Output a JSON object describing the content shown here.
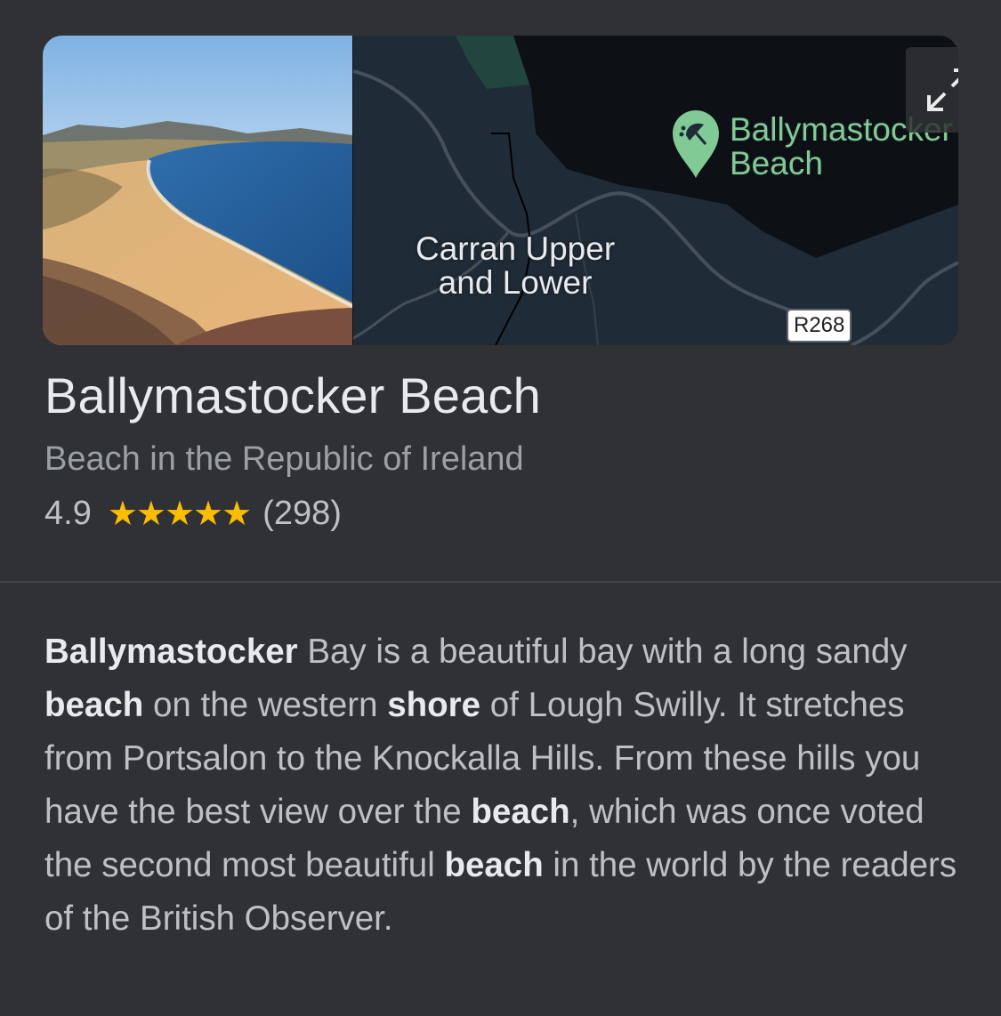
{
  "place": {
    "title": "Ballymastocker Beach",
    "subtitle": "Beach in the Republic of Ireland",
    "rating": "4.9",
    "stars": "★★★★★",
    "review_count": "(298)",
    "rating_value": 4.9,
    "rating_max": 5
  },
  "map": {
    "town_label_line1": "Carran Upper",
    "town_label_line2": "and Lower",
    "place_label_line1": "Ballymastocker",
    "place_label_line2": "Beach",
    "road_label": "R268",
    "pin_icon": "beach-umbrella-icon",
    "expand_icon": "expand-diagonal-icon"
  },
  "description": {
    "segments": [
      {
        "text": "Ballymastocker",
        "bold": true
      },
      {
        "text": " Bay is a beautiful bay with a long sandy ",
        "bold": false
      },
      {
        "text": "beach",
        "bold": true
      },
      {
        "text": " on the western ",
        "bold": false
      },
      {
        "text": "shore",
        "bold": true
      },
      {
        "text": " of Lough Swilly. It stretches from Portsalon to the Knockalla Hills. From these hills you have the best view over the ",
        "bold": false
      },
      {
        "text": "beach",
        "bold": true
      },
      {
        "text": ", which was once voted the second most beautiful ",
        "bold": false
      },
      {
        "text": "beach",
        "bold": true
      },
      {
        "text": " in the world by the readers of the British Observer.",
        "bold": false
      }
    ]
  },
  "colors": {
    "background": "#303134",
    "title": "#e8eaed",
    "subtitle": "#9aa0a6",
    "star": "#fbbc04",
    "pin": "#81c995",
    "map_water": "#0d1014",
    "map_land": "#1f2c38"
  }
}
